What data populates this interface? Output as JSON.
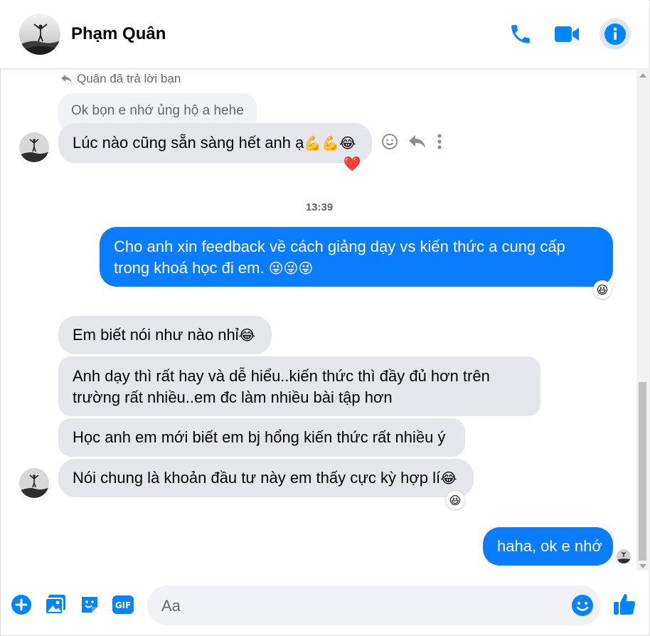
{
  "header": {
    "contact_name": "Phạm Quân",
    "call_icon": "phone-icon",
    "video_icon": "video-camera-icon",
    "info_icon": "info-icon"
  },
  "thread": {
    "reply_note": "Quân đã trả lời bạn",
    "quoted_message": "Ok bọn e nhớ ủng hộ a hehe",
    "reply_message": "Lúc nào cũng sẵn sàng hết anh ạ",
    "reply_emojis": "💪💪😂",
    "reply_reaction": "❤️",
    "timestamp": "13:39",
    "outgoing_1_line1": "Cho anh xin feedback về cách giảng dạy vs kiến thức a cung cấp",
    "outgoing_1_line2": "trong khoá học đi em. ",
    "outgoing_1_emojis": "😜😜😜",
    "outgoing_1_reaction": "😆",
    "incoming_1": "Em biết nói như nào nhỉ",
    "incoming_1_emoji": "😂",
    "incoming_2_line1": "Anh dạy thì rất hay và dễ hiểu..kiến thức thì đầy đủ hơn trên",
    "incoming_2_line2": "trường rất nhiều..em đc làm nhiều bài tập hơn",
    "incoming_3": "Học anh em mới biết em bj hổng kiến thức rất nhiều ý",
    "incoming_4": "Nói chung là khoản đầu tư này em thấy cực kỳ hợp lí",
    "incoming_4_emoji": "😂",
    "incoming_4_reaction": "😆",
    "outgoing_2": "haha, ok e nhớ"
  },
  "composer": {
    "placeholder": "Aa",
    "value": ""
  },
  "colors": {
    "accent": "#0084ff",
    "outgoing_bubble": "#0a7cff",
    "incoming_bubble": "#e4e6eb"
  }
}
